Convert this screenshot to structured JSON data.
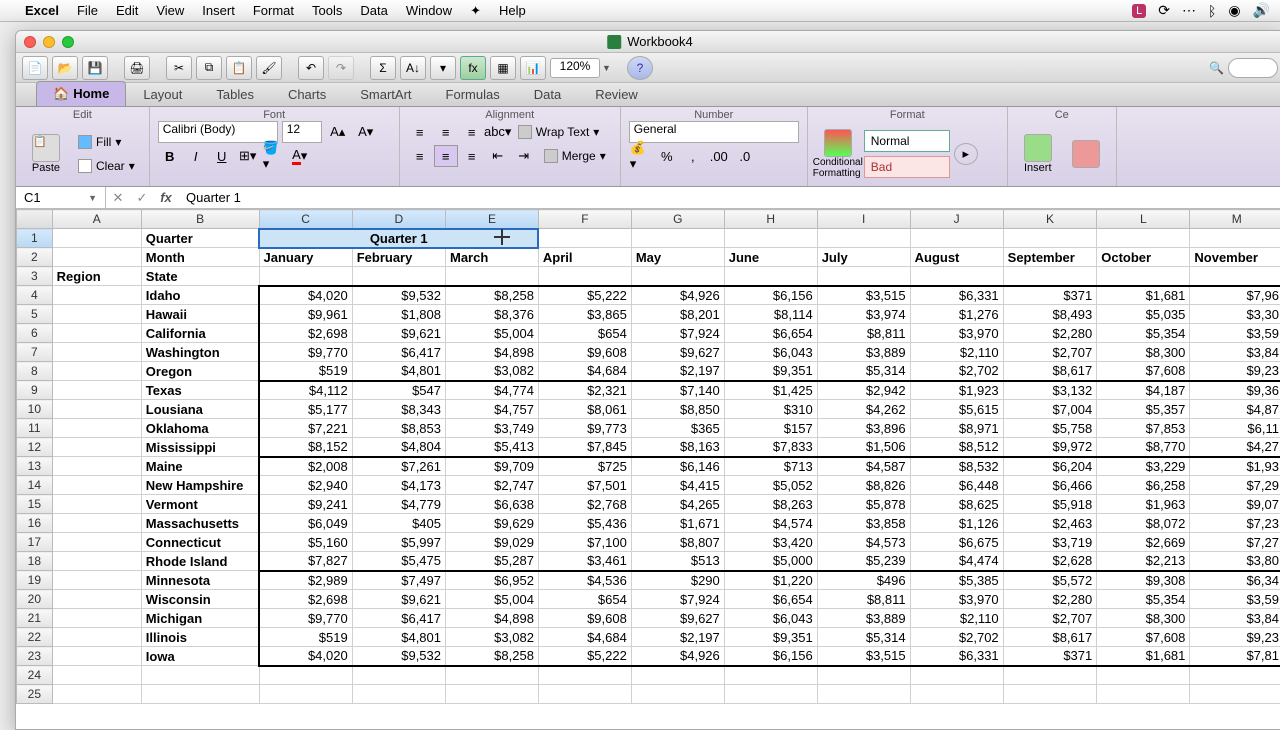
{
  "menubar": {
    "app": "Excel",
    "items": [
      "File",
      "Edit",
      "View",
      "Insert",
      "Format",
      "Tools",
      "Data",
      "Window",
      "Help"
    ]
  },
  "window": {
    "title": "Workbook4"
  },
  "toolbar": {
    "zoom": "120%"
  },
  "ribbon": {
    "tabs": [
      "Home",
      "Layout",
      "Tables",
      "Charts",
      "SmartArt",
      "Formulas",
      "Data",
      "Review"
    ],
    "groups": {
      "edit": "Edit",
      "font": "Font",
      "alignment": "Alignment",
      "number": "Number",
      "format": "Format",
      "cells": "Ce"
    },
    "paste": "Paste",
    "fill": "Fill",
    "clear": "Clear",
    "font_name": "Calibri (Body)",
    "font_size": "12",
    "wrap": "Wrap Text",
    "merge": "Merge",
    "number_format": "General",
    "cond_fmt": "Conditional Formatting",
    "style_normal": "Normal",
    "style_bad": "Bad",
    "insert": "Insert"
  },
  "formula": {
    "cell": "C1",
    "value": "Quarter 1"
  },
  "columns": [
    "A",
    "B",
    "C",
    "D",
    "E",
    "F",
    "G",
    "H",
    "I",
    "J",
    "K",
    "L",
    "M"
  ],
  "headers": {
    "quarter": "Quarter",
    "q1": "Quarter 1",
    "month": "Month",
    "months": [
      "January",
      "February",
      "March",
      "April",
      "May",
      "June",
      "July",
      "August",
      "September",
      "October",
      "November"
    ],
    "region": "Region",
    "state": "State"
  },
  "rows": [
    {
      "state": "Idaho",
      "v": [
        "$4,020",
        "$9,532",
        "$8,258",
        "$5,222",
        "$4,926",
        "$6,156",
        "$3,515",
        "$6,331",
        "$371",
        "$1,681",
        "$7,96"
      ]
    },
    {
      "state": "Hawaii",
      "v": [
        "$9,961",
        "$1,808",
        "$8,376",
        "$3,865",
        "$8,201",
        "$8,114",
        "$3,974",
        "$1,276",
        "$8,493",
        "$5,035",
        "$3,30"
      ]
    },
    {
      "state": "California",
      "v": [
        "$2,698",
        "$9,621",
        "$5,004",
        "$654",
        "$7,924",
        "$6,654",
        "$8,811",
        "$3,970",
        "$2,280",
        "$5,354",
        "$3,59"
      ]
    },
    {
      "state": "Washington",
      "v": [
        "$9,770",
        "$6,417",
        "$4,898",
        "$9,608",
        "$9,627",
        "$6,043",
        "$3,889",
        "$2,110",
        "$2,707",
        "$8,300",
        "$3,84"
      ]
    },
    {
      "state": "Oregon",
      "v": [
        "$519",
        "$4,801",
        "$3,082",
        "$4,684",
        "$2,197",
        "$9,351",
        "$5,314",
        "$2,702",
        "$8,617",
        "$7,608",
        "$9,23"
      ]
    },
    {
      "state": "Texas",
      "v": [
        "$4,112",
        "$547",
        "$4,774",
        "$2,321",
        "$7,140",
        "$1,425",
        "$2,942",
        "$1,923",
        "$3,132",
        "$4,187",
        "$9,36"
      ]
    },
    {
      "state": "Lousiana",
      "v": [
        "$5,177",
        "$8,343",
        "$4,757",
        "$8,061",
        "$8,850",
        "$310",
        "$4,262",
        "$5,615",
        "$7,004",
        "$5,357",
        "$4,87"
      ]
    },
    {
      "state": "Oklahoma",
      "v": [
        "$7,221",
        "$8,853",
        "$3,749",
        "$9,773",
        "$365",
        "$157",
        "$3,896",
        "$8,971",
        "$5,758",
        "$7,853",
        "$6,11"
      ]
    },
    {
      "state": "Mississippi",
      "v": [
        "$8,152",
        "$4,804",
        "$5,413",
        "$7,845",
        "$8,163",
        "$7,833",
        "$1,506",
        "$8,512",
        "$9,972",
        "$8,770",
        "$4,27"
      ]
    },
    {
      "state": "Maine",
      "v": [
        "$2,008",
        "$7,261",
        "$9,709",
        "$725",
        "$6,146",
        "$713",
        "$4,587",
        "$8,532",
        "$6,204",
        "$3,229",
        "$1,93"
      ]
    },
    {
      "state": "New Hampshire",
      "v": [
        "$2,940",
        "$4,173",
        "$2,747",
        "$7,501",
        "$4,415",
        "$5,052",
        "$8,826",
        "$6,448",
        "$6,466",
        "$6,258",
        "$7,29"
      ]
    },
    {
      "state": "Vermont",
      "v": [
        "$9,241",
        "$4,779",
        "$6,638",
        "$2,768",
        "$4,265",
        "$8,263",
        "$5,878",
        "$8,625",
        "$5,918",
        "$1,963",
        "$9,07"
      ]
    },
    {
      "state": "Massachusetts",
      "v": [
        "$6,049",
        "$405",
        "$9,629",
        "$5,436",
        "$1,671",
        "$4,574",
        "$3,858",
        "$1,126",
        "$2,463",
        "$8,072",
        "$7,23"
      ]
    },
    {
      "state": "Connecticut",
      "v": [
        "$5,160",
        "$5,997",
        "$9,029",
        "$7,100",
        "$8,807",
        "$3,420",
        "$4,573",
        "$6,675",
        "$3,719",
        "$2,669",
        "$7,27"
      ]
    },
    {
      "state": "Rhode Island",
      "v": [
        "$7,827",
        "$5,475",
        "$5,287",
        "$3,461",
        "$513",
        "$5,000",
        "$5,239",
        "$4,474",
        "$2,628",
        "$2,213",
        "$3,80"
      ]
    },
    {
      "state": "Minnesota",
      "v": [
        "$2,989",
        "$7,497",
        "$6,952",
        "$4,536",
        "$290",
        "$1,220",
        "$496",
        "$5,385",
        "$5,572",
        "$9,308",
        "$6,34"
      ]
    },
    {
      "state": "Wisconsin",
      "v": [
        "$2,698",
        "$9,621",
        "$5,004",
        "$654",
        "$7,924",
        "$6,654",
        "$8,811",
        "$3,970",
        "$2,280",
        "$5,354",
        "$3,59"
      ]
    },
    {
      "state": "Michigan",
      "v": [
        "$9,770",
        "$6,417",
        "$4,898",
        "$9,608",
        "$9,627",
        "$6,043",
        "$3,889",
        "$2,110",
        "$2,707",
        "$8,300",
        "$3,84"
      ]
    },
    {
      "state": "Illinois",
      "v": [
        "$519",
        "$4,801",
        "$3,082",
        "$4,684",
        "$2,197",
        "$9,351",
        "$5,314",
        "$2,702",
        "$8,617",
        "$7,608",
        "$9,23"
      ]
    },
    {
      "state": "Iowa",
      "v": [
        "$4,020",
        "$9,532",
        "$8,258",
        "$5,222",
        "$4,926",
        "$6,156",
        "$3,515",
        "$6,331",
        "$371",
        "$1,681",
        "$7,81"
      ]
    }
  ]
}
